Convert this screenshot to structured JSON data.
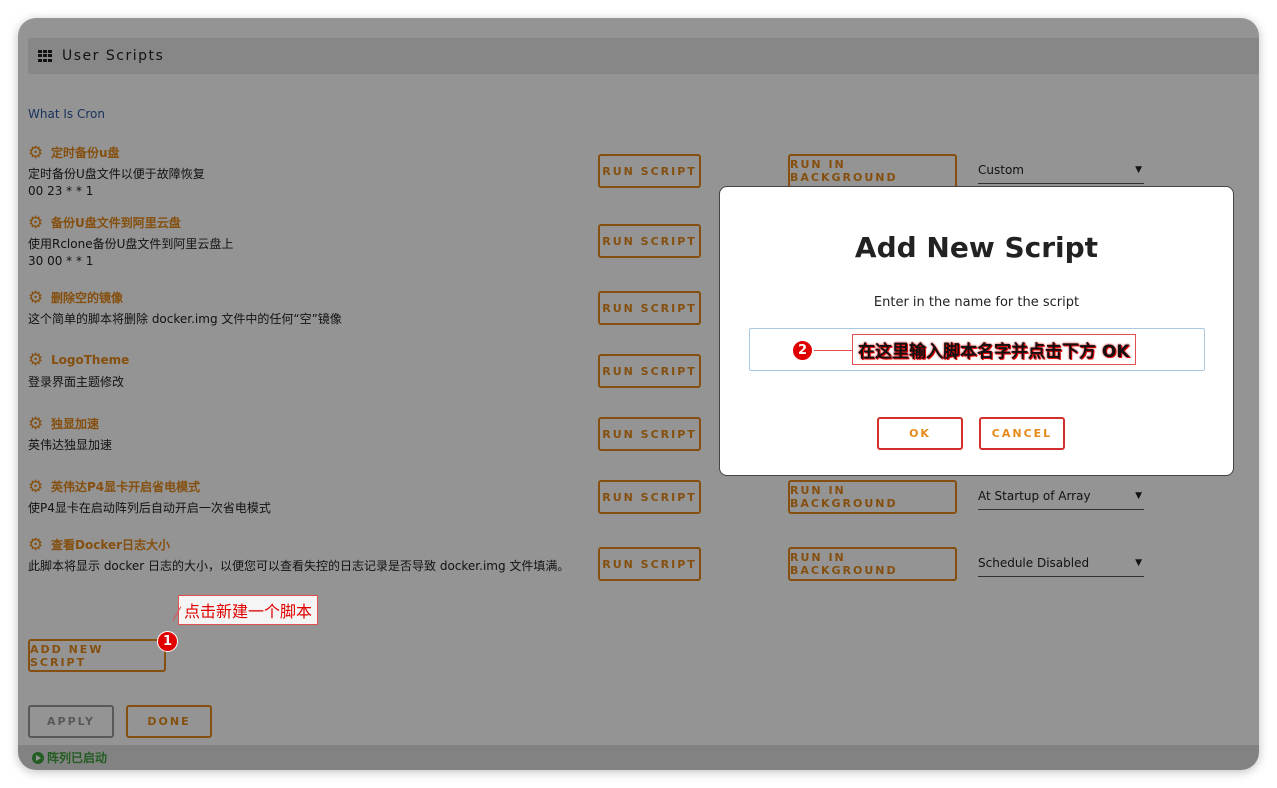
{
  "header": {
    "title": "User Scripts"
  },
  "cron_link": "What Is Cron",
  "labels": {
    "run_script": "RUN SCRIPT",
    "run_in_background": "RUN IN BACKGROUND"
  },
  "scripts": [
    {
      "name": "定时备份u盘",
      "desc": "定时备份U盘文件以便于故障恢复",
      "cron": "00 23 * * 1",
      "schedule": "Custom"
    },
    {
      "name": "备份U盘文件到阿里云盘",
      "desc": "使用Rclone备份U盘文件到阿里云盘上",
      "cron": "30 00 * * 1"
    },
    {
      "name": "删除空的镜像",
      "desc": "这个简单的脚本将删除 docker.img 文件中的任何“空”镜像"
    },
    {
      "name": "LogoTheme",
      "desc": "登录界面主题修改"
    },
    {
      "name": "独显加速",
      "desc": "英伟达独显加速"
    },
    {
      "name": "英伟达P4显卡开启省电模式",
      "desc": "使P4显卡在启动阵列后自动开启一次省电模式",
      "schedule": "At Startup of Array"
    },
    {
      "name": "查看Docker日志大小",
      "desc": "此脚本将显示 docker 日志的大小，以便您可以查看失控的日志记录是否导致 docker.img 文件填满。",
      "schedule": "Schedule Disabled"
    }
  ],
  "buttons": {
    "add_new_script": "ADD NEW SCRIPT",
    "apply": "APPLY",
    "done": "DONE"
  },
  "status": {
    "text": "阵列已启动"
  },
  "modal": {
    "title": "Add New Script",
    "prompt": "Enter in the name for the script",
    "ok": "OK",
    "cancel": "CANCEL"
  },
  "annotations": {
    "one": {
      "number": "1",
      "text": "点击新建一个脚本"
    },
    "two": {
      "number": "2",
      "text": "在这里输入脚本名字并点击下方 OK"
    }
  },
  "colors": {
    "accent": "#e68a1a",
    "link": "#2d57a1",
    "status_green": "#3da03d",
    "annotation_red": "#e00000"
  }
}
